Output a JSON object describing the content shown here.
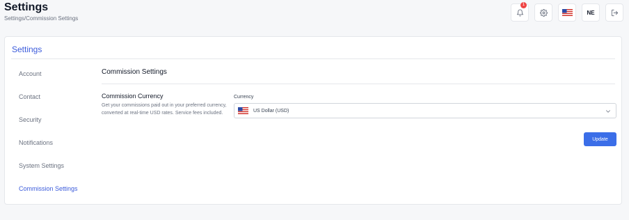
{
  "header": {
    "title": "Settings",
    "breadcrumb": "Settings/Commission Settings"
  },
  "topbar": {
    "notifications_badge": "1",
    "notification_icon": "bell-icon",
    "settings_icon": "gear-icon",
    "language_icon": "us-flag-icon",
    "user_initials": "NE",
    "logout_icon": "logout-icon"
  },
  "card": {
    "title": "Settings"
  },
  "sidebar": {
    "items": [
      {
        "label": "Account",
        "active": false
      },
      {
        "label": "Contact",
        "active": false
      },
      {
        "label": "Security",
        "active": false
      },
      {
        "label": "Notifications",
        "active": false
      },
      {
        "label": "System Settings",
        "active": false
      },
      {
        "label": "Commission Settings",
        "active": true
      }
    ]
  },
  "main": {
    "section_title": "Commission Settings",
    "field_title": "Commission Currency",
    "field_description": "Get your commissions paid out in your preferred currency, converted at real-time USD rates. Service fees included.",
    "currency_label": "Currency",
    "currency_value": "US Dollar (USD)",
    "currency_flag_icon": "us-flag-icon",
    "update_label": "Update"
  },
  "colors": {
    "accent": "#3b5bdb",
    "button": "#3b6ee8",
    "badge": "#ef4444"
  }
}
